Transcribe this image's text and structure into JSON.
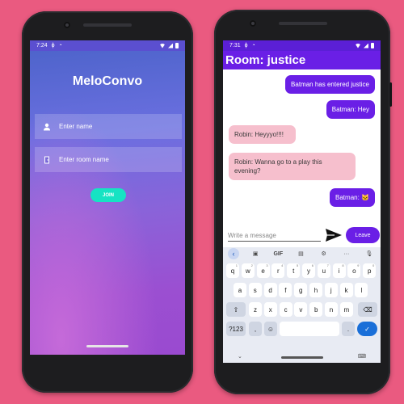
{
  "left_phone": {
    "status": {
      "time": "7:24"
    },
    "app_title": "MeloConvo",
    "name_placeholder": "Enter name",
    "room_placeholder": "Enter room name",
    "join_label": "JOIN"
  },
  "right_phone": {
    "status": {
      "time": "7:31"
    },
    "room_title": "Room: justice",
    "messages": [
      {
        "side": "sent",
        "text": "Batman has entered justice"
      },
      {
        "side": "sent",
        "text": "Batman: Hey"
      },
      {
        "side": "recv",
        "text": "Robin: Heyyyo!!!!"
      },
      {
        "side": "recv",
        "text": "Robin: Wanna go to a play this evening?"
      },
      {
        "side": "sent",
        "text": "Batman: 🐱"
      }
    ],
    "message_placeholder": "Write a message",
    "leave_label": "Leave",
    "keyboard": {
      "toolbar": [
        "GIF",
        "···"
      ],
      "row1": [
        "q",
        "w",
        "e",
        "r",
        "t",
        "y",
        "u",
        "i",
        "o",
        "p"
      ],
      "row1_hints": [
        "1",
        "2",
        "3",
        "4",
        "5",
        "6",
        "7",
        "8",
        "9",
        "0"
      ],
      "row2": [
        "a",
        "s",
        "d",
        "f",
        "g",
        "h",
        "j",
        "k",
        "l"
      ],
      "row3": [
        "z",
        "x",
        "c",
        "v",
        "b",
        "n",
        "m"
      ],
      "row4": [
        "?123",
        ",",
        ".",
        ""
      ]
    }
  },
  "colors": {
    "background": "#ea5a80",
    "header_purple": "#6a1fe6",
    "join_teal": "#16e3c3",
    "received_bubble": "#f6bfcd"
  }
}
